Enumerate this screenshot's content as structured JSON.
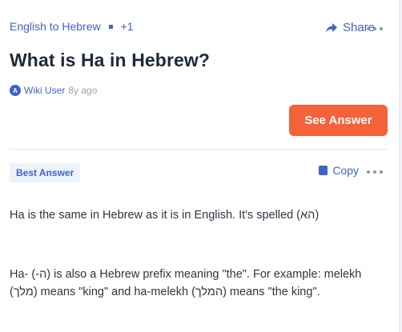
{
  "breadcrumb": {
    "topic": "English to Hebrew",
    "extra": "+1"
  },
  "header": {
    "share_label": "Share"
  },
  "question": {
    "title": "What is Ha in Hebrew?"
  },
  "author": {
    "name": "Wiki User",
    "age": "8y ago",
    "avatar_letter": "A"
  },
  "actions": {
    "see_answer_label": "See Answer"
  },
  "answer": {
    "badge": "Best Answer",
    "copy_label": "Copy",
    "paragraphs": [
      "Ha is the same in Hebrew as it is in English. It's spelled (הא)",
      "Ha- (-ה) is also a Hebrew prefix meaning \"the\". For example: melekh (מלך) means \"king\" and ha-melekh (המלך) means \"the king\"."
    ]
  },
  "colors": {
    "accent": "#3d63c9",
    "cta": "#f4623a",
    "title": "#1d2a3a",
    "text": "#2c3542",
    "muted": "#9aa3ae"
  },
  "icons": {
    "share": "share-arrow-icon",
    "more": "more-dots-icon",
    "copy": "copy-icon",
    "avatar": "user-avatar-icon"
  }
}
